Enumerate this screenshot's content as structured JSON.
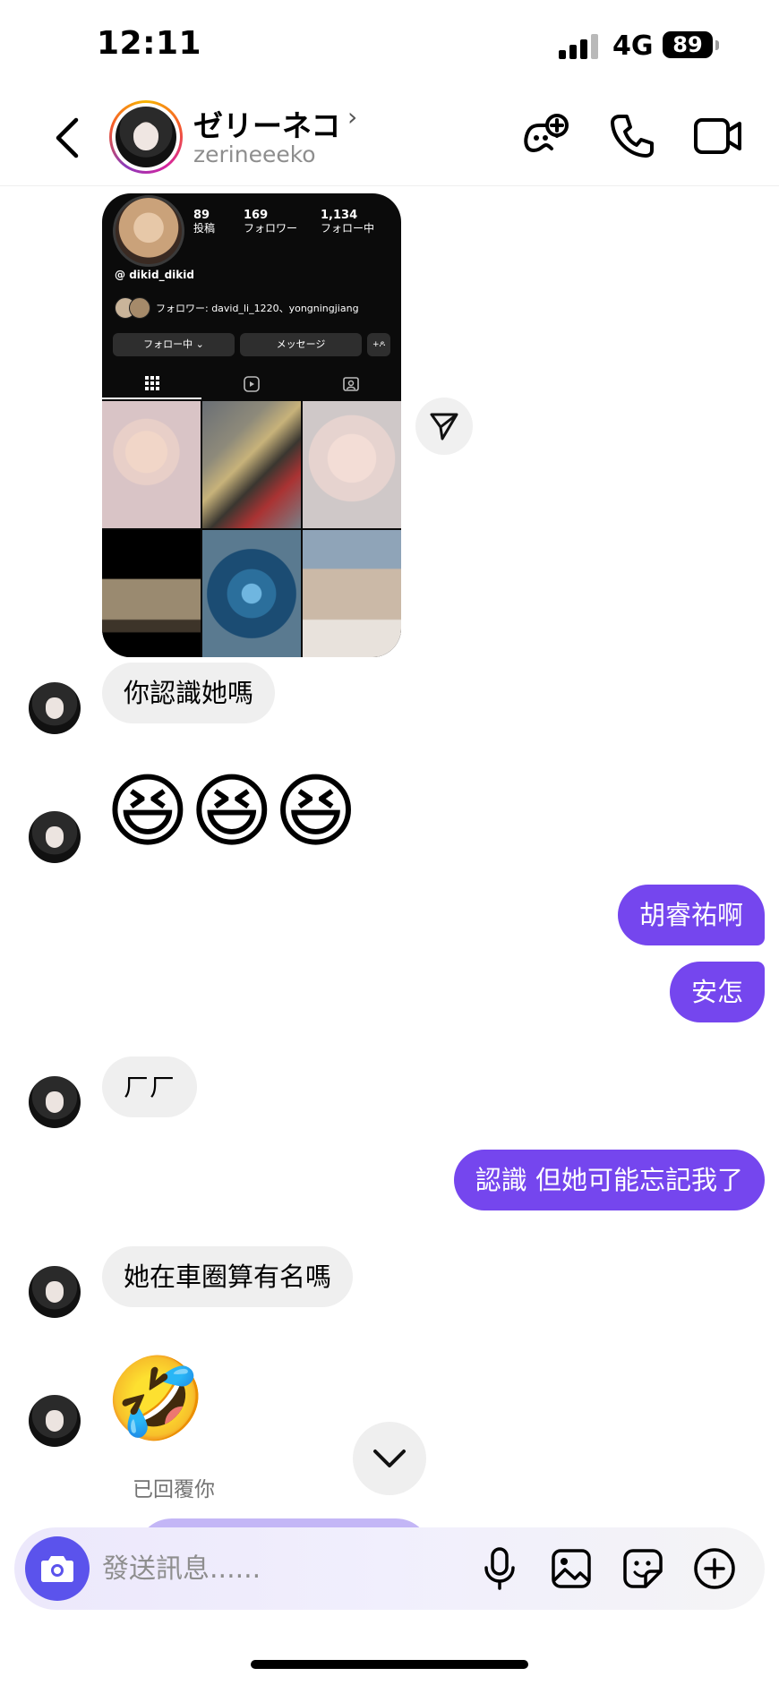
{
  "status_bar": {
    "time": "12:11",
    "network": "4G",
    "battery": "89"
  },
  "header": {
    "contact_name": "ゼリーネコ",
    "contact_handle": "zerineeeko",
    "name_chevron": "›"
  },
  "shared_post": {
    "stats": [
      {
        "count": "89",
        "label": "投稿"
      },
      {
        "count": "169",
        "label": "フォロワー"
      },
      {
        "count": "1,134",
        "label": "フォロー中"
      }
    ],
    "handle": "dikid_dikid",
    "followers_line": "フォロワー: david_li_1220、yongningjiang",
    "follow_button": "フォロー中 ⌄",
    "message_button": "メッセージ",
    "add_button": "+ዶ"
  },
  "messages": [
    {
      "side": "in",
      "text": "你認識她嗎"
    },
    {
      "side": "in",
      "emoji": "😆😆😆"
    },
    {
      "side": "out",
      "text": "胡睿祐啊"
    },
    {
      "side": "out",
      "text": "安怎"
    },
    {
      "side": "in",
      "text": "ㄏㄏ"
    },
    {
      "side": "out",
      "text": "認識 但她可能忘記我了"
    },
    {
      "side": "in",
      "text": "她在車圈算有名嗎"
    },
    {
      "side": "in",
      "emoji": "🤣"
    }
  ],
  "replied_label": "已回覆你",
  "composer": {
    "placeholder": "發送訊息......"
  },
  "colors": {
    "accent": "#7546ee",
    "camera": "#5b53ec",
    "incoming_bubble": "#efefef"
  }
}
